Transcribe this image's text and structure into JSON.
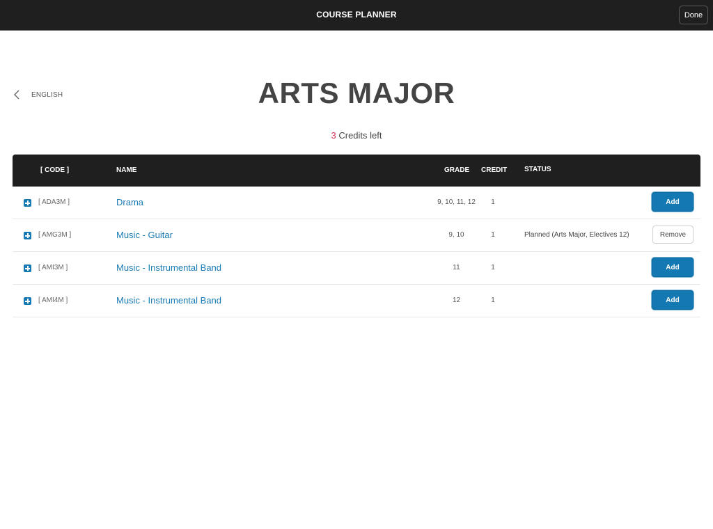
{
  "topbar": {
    "title": "COURSE PLANNER",
    "done_label": "Done"
  },
  "back": {
    "label": "ENGLISH",
    "icon": "chevron-left-icon"
  },
  "page": {
    "title": "ARTS MAJOR",
    "credits_left": "3",
    "credits_suffix": " Credits left"
  },
  "table": {
    "headers": {
      "code": "[  CODE  ]",
      "name": "NAME",
      "grade": "GRADE",
      "credit": "CREDIT",
      "status": "STATUS"
    },
    "rows": [
      {
        "code": "[ ADA3M ]",
        "name": "Drama",
        "grade": "9, 10, 11, 12",
        "credit": "1",
        "status": "",
        "action": "Add"
      },
      {
        "code": "[ AMG3M ]",
        "name": "Music - Guitar",
        "grade": "9, 10",
        "credit": "1",
        "status": "Planned (Arts Major, Electives 12)",
        "action": "Remove"
      },
      {
        "code": "[ AMI3M ]",
        "name": "Music - Instrumental Band",
        "grade": "11",
        "credit": "1",
        "status": "",
        "action": "Add"
      },
      {
        "code": "[ AMI4M ]",
        "name": "Music - Instrumental Band",
        "grade": "12",
        "credit": "1",
        "status": "",
        "action": "Add"
      }
    ]
  },
  "colors": {
    "accent": "#1479b3",
    "credits_highlight": "#d2335a",
    "header_bg": "#1f1f1f"
  }
}
